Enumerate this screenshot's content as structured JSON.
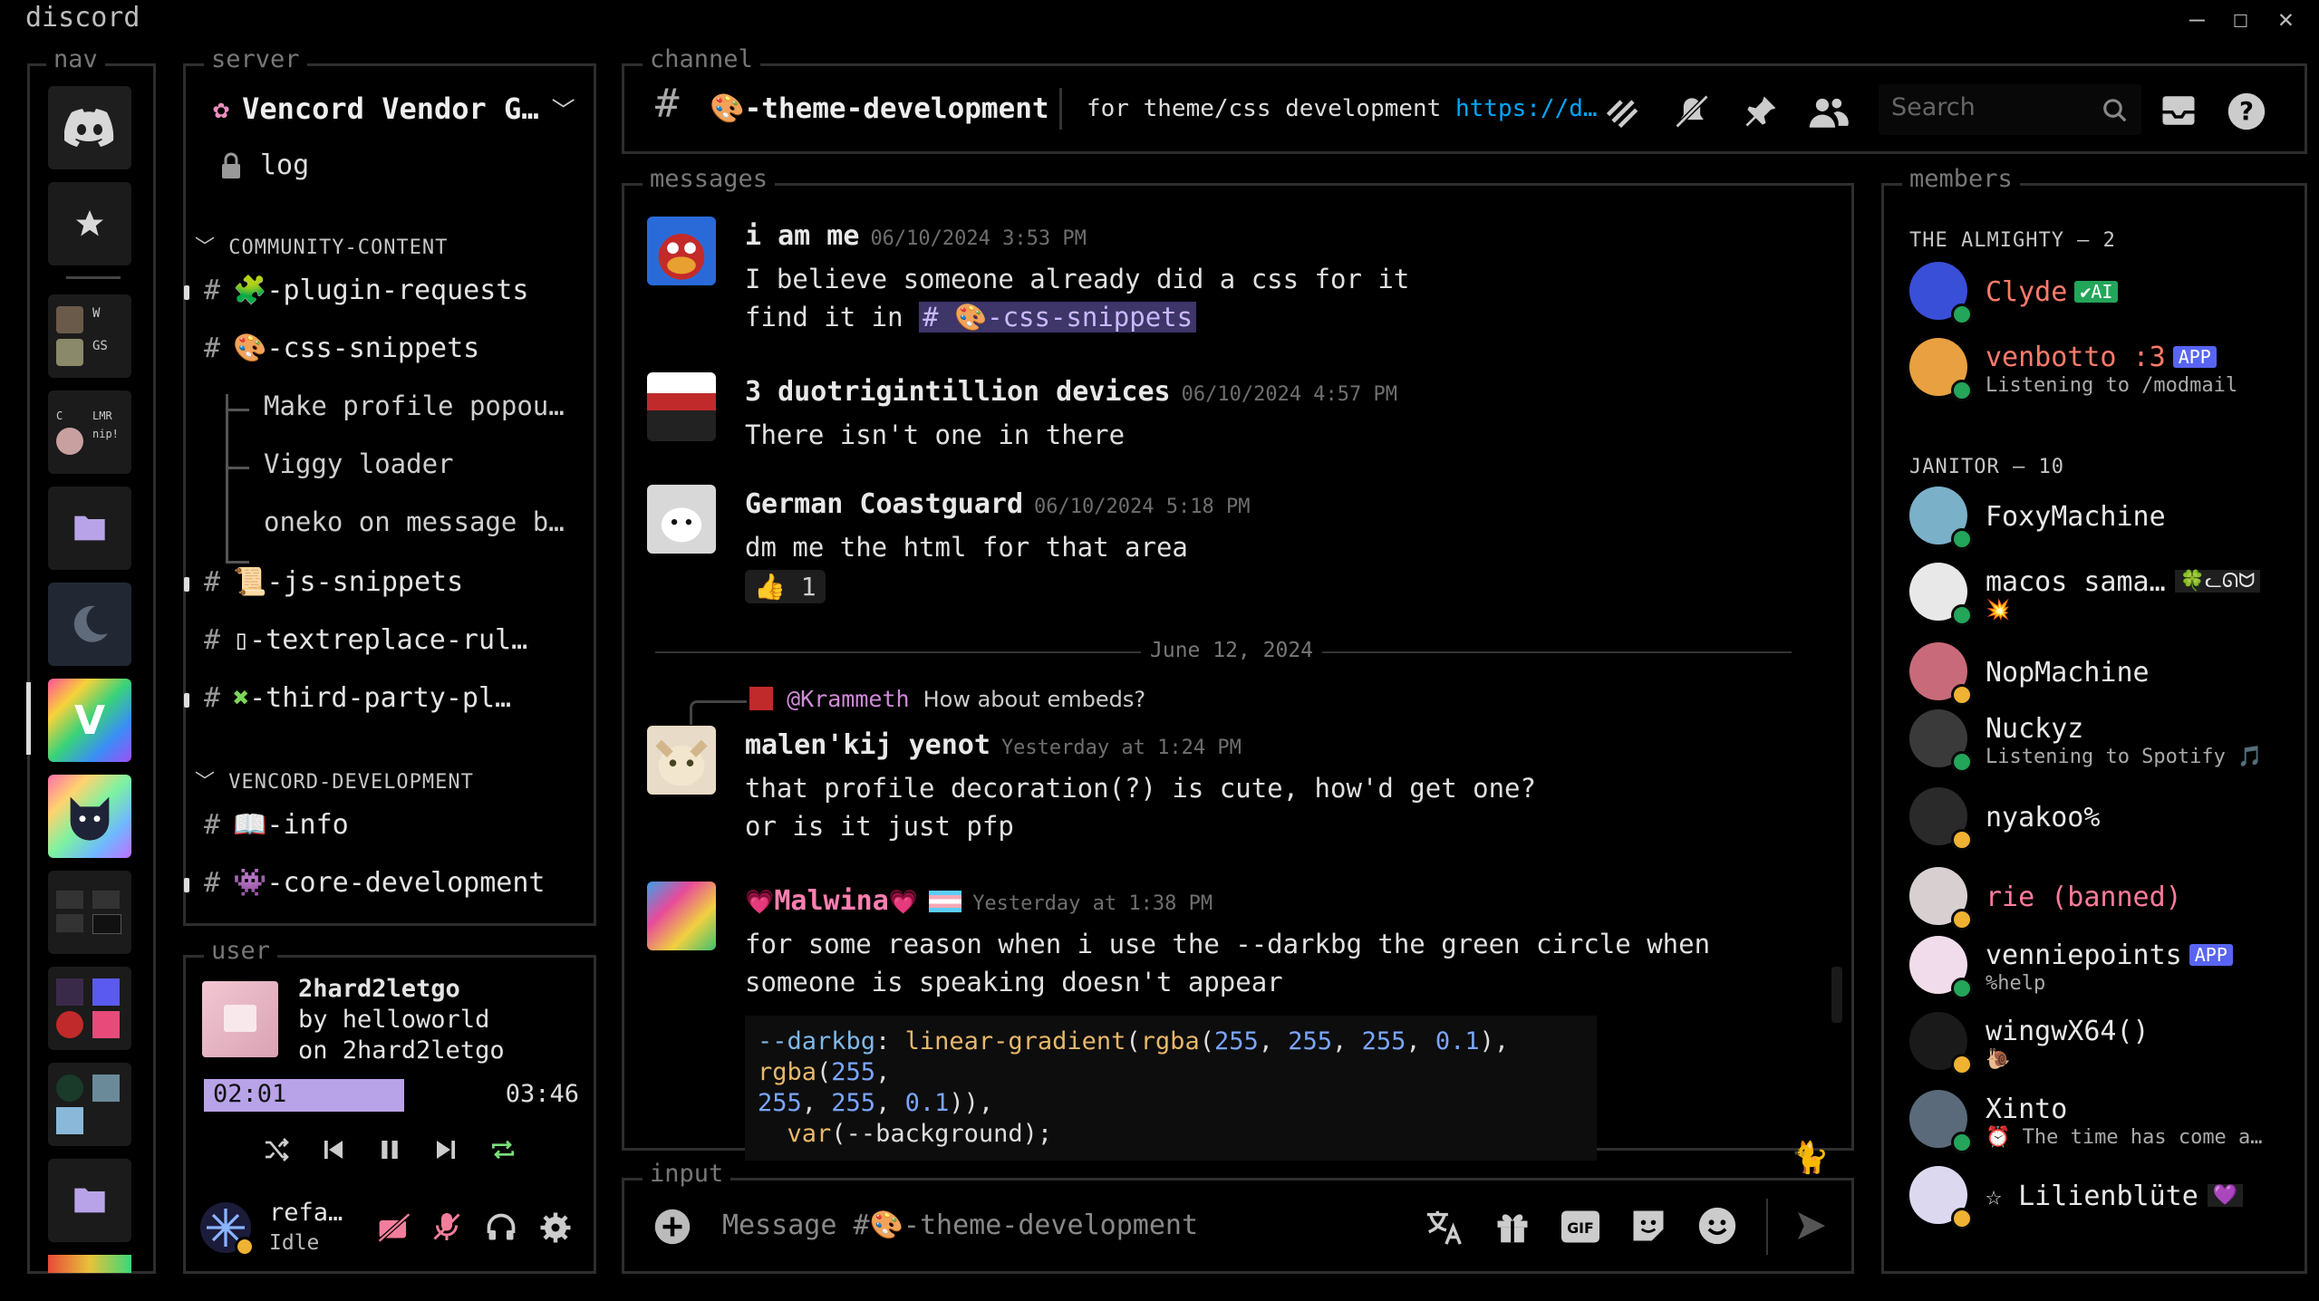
{
  "app_title": "discord",
  "window_controls": {
    "minimize": "—",
    "maximize": "☐",
    "close": "✕"
  },
  "panel_labels": {
    "nav": "nav",
    "server": "server",
    "channel": "channel",
    "messages": "messages",
    "members": "members",
    "user": "user",
    "input": "input"
  },
  "server": {
    "name": "Vencord Vendor G…",
    "log_label": "log",
    "categories": [
      {
        "name": "COMMUNITY-CONTENT"
      },
      {
        "name": "VENCORD-DEVELOPMENT"
      }
    ],
    "channels": {
      "plugin_requests": {
        "emoji": "🧩",
        "name": "-plugin-requests"
      },
      "css_snippets": {
        "emoji": "🎨",
        "name": "-css-snippets"
      },
      "thread1": "Make profile popou…",
      "thread2": "Viggy loader",
      "thread3": "oneko on message b…",
      "js_snippets": {
        "emoji": "📜",
        "name": "-js-snippets"
      },
      "textreplace": {
        "emoji": "▯",
        "name": "-textreplace-rul…"
      },
      "third_party": {
        "emoji": "✖",
        "name": "-third-party-pl…"
      },
      "info": {
        "emoji": "📖",
        "name": "-info"
      },
      "core_dev": {
        "emoji": "👾",
        "name": "-core-development"
      }
    }
  },
  "channel_header": {
    "emoji": "🎨",
    "name": "-theme-development",
    "topic": "for theme/css development",
    "link": "https://d…",
    "search_placeholder": "Search"
  },
  "messages": [
    {
      "author": "i am me",
      "timestamp": "06/10/2024 3:53 PM",
      "lines": [
        "I believe someone already did a css for it",
        "find it in"
      ],
      "mention": "# 🎨-css-snippets"
    },
    {
      "author": "3 duotrigintillion devices",
      "timestamp": "06/10/2024 4:57 PM",
      "lines": [
        "There isn't one in there"
      ]
    },
    {
      "author": "German Coastguard",
      "timestamp": "06/10/2024 5:18 PM",
      "lines": [
        "dm me the html for that area"
      ],
      "reaction": {
        "emoji": "👍",
        "count": "1"
      }
    },
    {
      "divider": "June 12, 2024"
    },
    {
      "reply_to": "@Krammeth",
      "reply_text": "How about embeds?",
      "author": "malen'kij yenot",
      "timestamp": "Yesterday at 1:24 PM",
      "lines": [
        "that profile decoration(?) is cute, how'd get one?",
        "or is it just pfp"
      ]
    },
    {
      "author": "Malwina",
      "author_prefix": "💗",
      "author_suffix": "💗",
      "timestamp": "Yesterday at 1:38 PM",
      "lines": [
        "for some reason when i use the --darkbg the green circle when",
        "someone is speaking doesn't appear"
      ],
      "code": {
        "var": "--darkbg",
        "fn": "linear-gradient",
        "rgba": "rgba",
        "n255": "255",
        "n01": "0.1",
        "var2": "var",
        "bg": "--background"
      }
    }
  ],
  "members": {
    "groups": [
      {
        "title": "THE ALMIGHTY — 2"
      },
      {
        "title": "JANITOR — 10"
      }
    ],
    "list": [
      {
        "name": "Clyde",
        "badge": "✔AI",
        "color": "#ff7b6b",
        "status": "#23a55a"
      },
      {
        "name": "venbotto :3",
        "badge": "APP",
        "activity": "Listening to /modmail",
        "color": "#ff7b6b",
        "status": "#23a55a"
      },
      {
        "name": "FoxyMachine",
        "color": "#e8e8e8",
        "status": "#23a55a"
      },
      {
        "name": "macos sama…",
        "activity": "💥",
        "tag": "🍀ᓚᘏᗢ",
        "color": "#e8e8e8",
        "status": "#23a55a"
      },
      {
        "name": "NopMachine",
        "color": "#e8e8e8",
        "status": "#f0b232"
      },
      {
        "name": "Nuckyz",
        "activity": "Listening to Spotify 🎵",
        "color": "#e8e8e8",
        "status": "#23a55a"
      },
      {
        "name": "nyakoo%",
        "color": "#e8e8e8",
        "status": "#f0b232"
      },
      {
        "name": "rie (banned)",
        "color": "#ff7b9b",
        "status": "#f0b232"
      },
      {
        "name": "venniepoints",
        "badge": "APP",
        "activity": "%help",
        "color": "#e8e8e8",
        "status": "#23a55a"
      },
      {
        "name": "wingwX64()",
        "activity": "🐌",
        "color": "#e8e8e8",
        "status": "#f0b232"
      },
      {
        "name": "Xinto",
        "activity": "⏰ The time has come a…",
        "color": "#e8e8e8",
        "status": "#23a55a"
      },
      {
        "name": "☆ Lilienblüte",
        "tag": "💜",
        "color": "#e8e8e8",
        "status": "#f0b232"
      }
    ]
  },
  "player": {
    "title": "2hard2letgo",
    "artist": "by helloworld",
    "album": "on 2hard2letgo",
    "elapsed": "02:01",
    "total": "03:46",
    "progress": 0.535
  },
  "user": {
    "name": "refa…",
    "status": "Idle"
  },
  "input": {
    "placeholder": "Message #🎨-theme-development"
  },
  "colors": {
    "accent": "#b9a3e8",
    "link": "#00a8fc",
    "online": "#23a55a",
    "idle": "#f0b232"
  }
}
